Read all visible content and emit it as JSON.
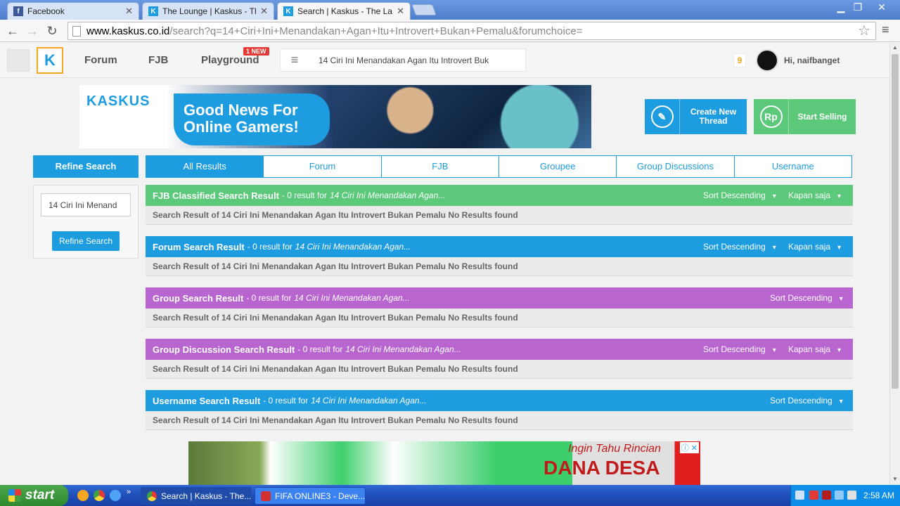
{
  "browser": {
    "tabs": [
      {
        "title": "Facebook",
        "favicon": "facebook-icon",
        "active": false
      },
      {
        "title": "The Lounge | Kaskus - The L",
        "favicon": "kaskus-icon",
        "active": false
      },
      {
        "title": "Search | Kaskus - The Larges",
        "favicon": "kaskus-icon",
        "active": true
      }
    ],
    "url_domain": "www.kaskus.co.id",
    "url_path": "/search?q=14+Ciri+Ini+Menandakan+Agan+Itu+Introvert+Bukan+Pemalu&forumchoice="
  },
  "header": {
    "nav": [
      "Forum",
      "FJB",
      "Playground"
    ],
    "new_badge": "1 NEW",
    "search_query": "14 Ciri Ini Menandakan Agan Itu Introvert Buk",
    "notif_count": "9",
    "greeting": "Hi, naifbanget"
  },
  "banner": {
    "logo": "KASKUS",
    "headline_1": "Good News For",
    "headline_2": "Online Gamers!"
  },
  "actions": {
    "create_thread": "Create New Thread",
    "start_selling": "Start Selling"
  },
  "refine": {
    "heading": "Refine Search",
    "input_value": "14 Ciri Ini Menand",
    "button": "Refine Search"
  },
  "tabs": [
    "All Results",
    "Forum",
    "FJB",
    "Groupee",
    "Group Discussions",
    "Username"
  ],
  "sections": [
    {
      "title": "FJB Classified Search Result",
      "count": " - 0 result for",
      "query": "14 Ciri Ini Menandakan Agan...",
      "sort": "Sort Descending",
      "time": "Kapan saja",
      "body": "Search Result of 14 Ciri Ini Menandakan Agan Itu Introvert Bukan Pemalu No Results found",
      "color": "#5cc879"
    },
    {
      "title": "Forum Search Result",
      "count": " - 0 result for",
      "query": "14 Ciri Ini Menandakan Agan...",
      "sort": "Sort Descending",
      "time": "Kapan saja",
      "body": "Search Result of 14 Ciri Ini Menandakan Agan Itu Introvert Bukan Pemalu No Results found",
      "color": "#1d9ce0"
    },
    {
      "title": "Group Search Result",
      "count": " - 0 result for",
      "query": "14 Ciri Ini Menandakan Agan...",
      "sort": "Sort Descending",
      "body": "Search Result of 14 Ciri Ini Menandakan Agan Itu Introvert Bukan Pemalu No Results found",
      "color": "#b865cf"
    },
    {
      "title": "Group Discussion Search Result",
      "count": " - 0 result for",
      "query": "14 Ciri Ini Menandakan Agan...",
      "sort": "Sort Descending",
      "time": "Kapan saja",
      "body": "Search Result of 14 Ciri Ini Menandakan Agan Itu Introvert Bukan Pemalu No Results found",
      "color": "#b865cf"
    },
    {
      "title": "Username Search Result",
      "count": " - 0 result for",
      "query": "14 Ciri Ini Menandakan Agan...",
      "sort": "Sort Descending",
      "body": "Search Result of 14 Ciri Ini Menandakan Agan Itu Introvert Bukan Pemalu No Results found",
      "color": "#1d9ce0"
    }
  ],
  "ad": {
    "line1": "Ingin Tahu Rincian",
    "line2": "DANA DESA"
  },
  "taskbar": {
    "start": "start",
    "tasks": [
      "Search | Kaskus - The...",
      "FIFA ONLINE3 - Deve..."
    ],
    "clock": "2:58 AM"
  }
}
